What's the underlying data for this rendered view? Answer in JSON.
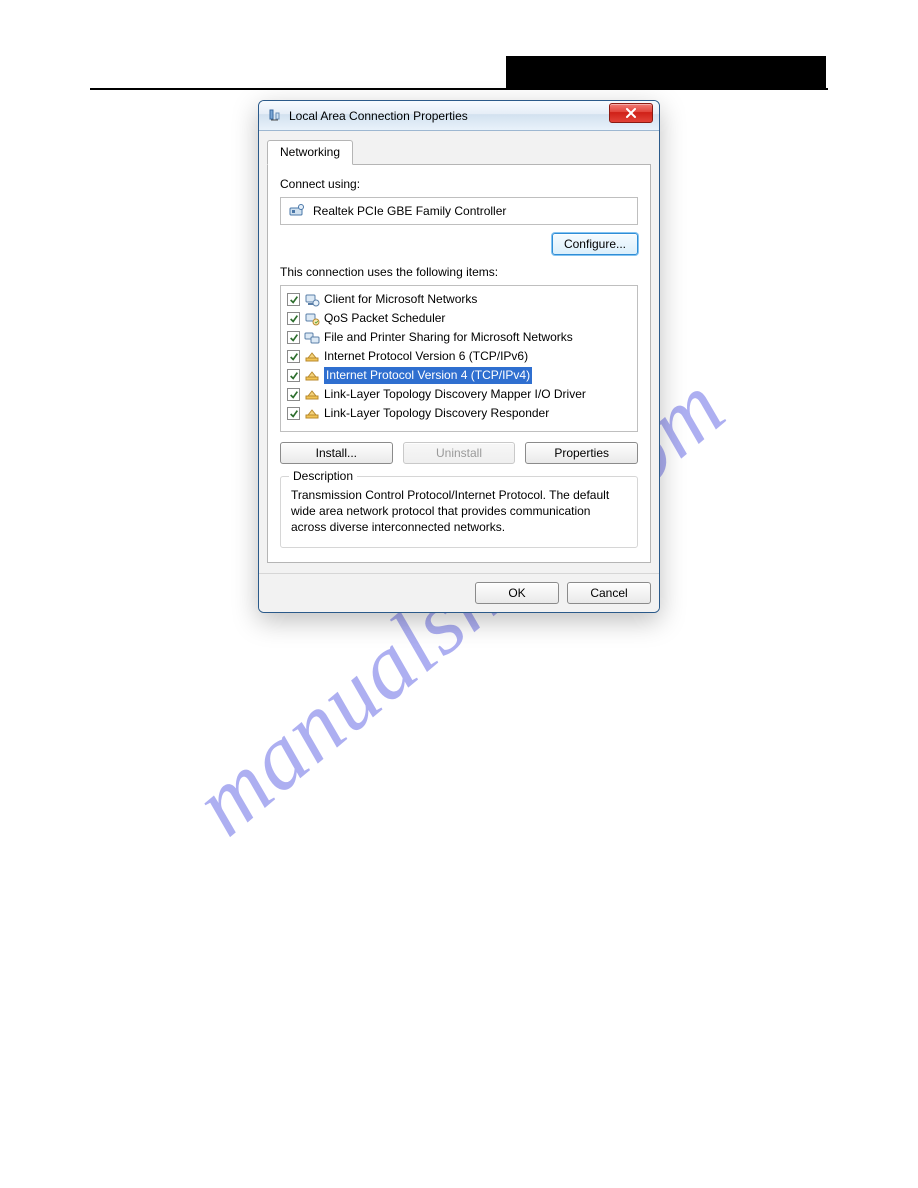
{
  "watermark": "manualshive.com",
  "dialog": {
    "title": "Local Area Connection Properties",
    "tab_label": "Networking",
    "connect_using_label": "Connect using:",
    "adapter_name": "Realtek PCIe GBE Family Controller",
    "configure_btn": "Configure...",
    "items_label": "This connection uses the following items:",
    "items": [
      {
        "label": "Client for Microsoft Networks",
        "checked": true,
        "selected": false,
        "icon": "client"
      },
      {
        "label": "QoS Packet Scheduler",
        "checked": true,
        "selected": false,
        "icon": "qos"
      },
      {
        "label": "File and Printer Sharing for Microsoft Networks",
        "checked": true,
        "selected": false,
        "icon": "share"
      },
      {
        "label": "Internet Protocol Version 6 (TCP/IPv6)",
        "checked": true,
        "selected": false,
        "icon": "proto"
      },
      {
        "label": "Internet Protocol Version 4 (TCP/IPv4)",
        "checked": true,
        "selected": true,
        "icon": "proto"
      },
      {
        "label": "Link-Layer Topology Discovery Mapper I/O Driver",
        "checked": true,
        "selected": false,
        "icon": "proto"
      },
      {
        "label": "Link-Layer Topology Discovery Responder",
        "checked": true,
        "selected": false,
        "icon": "proto"
      }
    ],
    "install_btn": "Install...",
    "uninstall_btn": "Uninstall",
    "properties_btn": "Properties",
    "desc_title": "Description",
    "desc_text": "Transmission Control Protocol/Internet Protocol. The default wide area network protocol that provides communication across diverse interconnected networks.",
    "ok_btn": "OK",
    "cancel_btn": "Cancel"
  }
}
